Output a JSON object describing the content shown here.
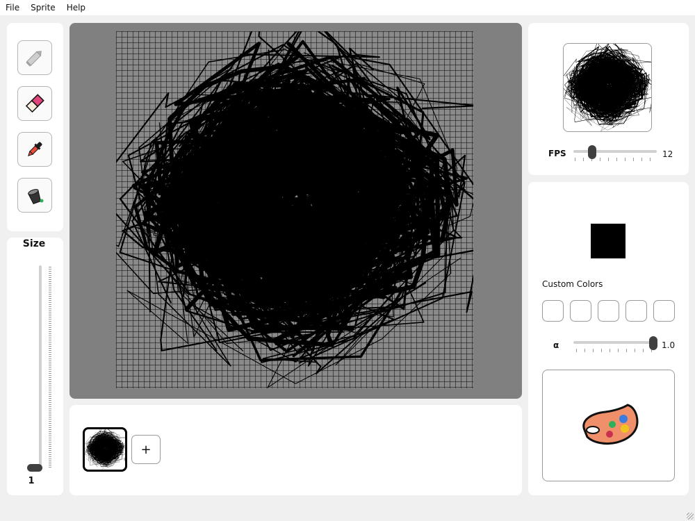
{
  "menu": {
    "items": [
      "File",
      "Sprite",
      "Help"
    ]
  },
  "tools": [
    {
      "name": "pencil-icon"
    },
    {
      "name": "eraser-icon"
    },
    {
      "name": "eyedropper-icon"
    },
    {
      "name": "fill-bucket-icon"
    }
  ],
  "size": {
    "title": "Size",
    "value": "1"
  },
  "frames": {
    "add_label": "+"
  },
  "preview": {
    "fps_label": "FPS",
    "fps_value": "12"
  },
  "color": {
    "current": "#000000",
    "custom_title": "Custom Colors",
    "alpha_label": "α",
    "alpha_value": "1.0"
  },
  "icons": {
    "palette": "palette-icon"
  }
}
